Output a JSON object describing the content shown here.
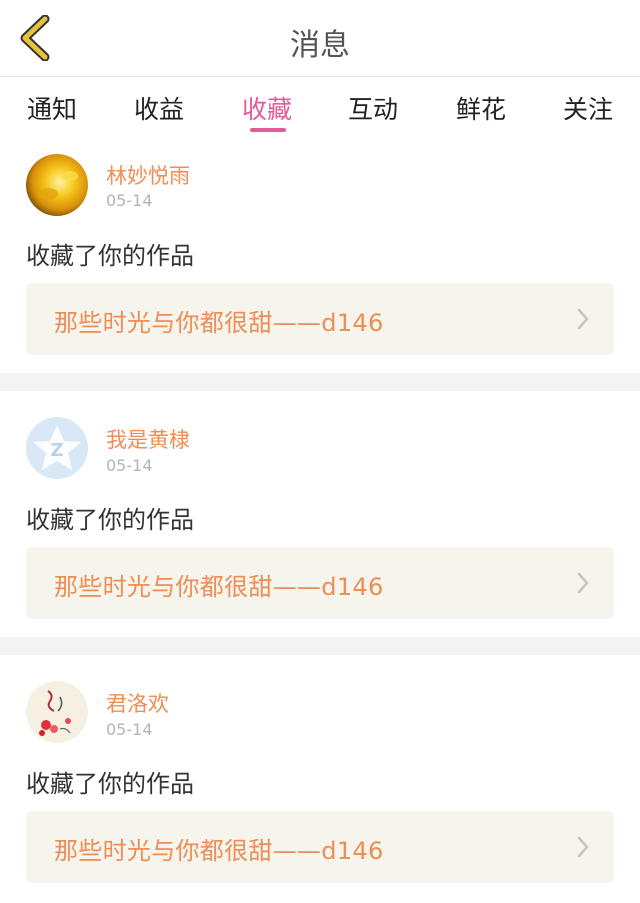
{
  "header": {
    "title": "消息",
    "back_icon": "chevron-left-icon"
  },
  "tabs": [
    {
      "label": "通知",
      "active": false
    },
    {
      "label": "收益",
      "active": false
    },
    {
      "label": "收藏",
      "active": true
    },
    {
      "label": "互动",
      "active": false
    },
    {
      "label": "鲜花",
      "active": false
    },
    {
      "label": "关注",
      "active": false
    }
  ],
  "messages": [
    {
      "user": "林妙悦雨",
      "time": "05-14",
      "action": "收藏了你的作品",
      "work": "那些时光与你都很甜——d146",
      "avatar": "sunflower-avatar"
    },
    {
      "user": "我是黄棣",
      "time": "05-14",
      "action": "收藏了你的作品",
      "work": "那些时光与你都很甜——d146",
      "avatar": "default-qq-avatar"
    },
    {
      "user": "君洛欢",
      "time": "05-14",
      "action": "收藏了你的作品",
      "work": "那些时光与你都很甜——d146",
      "avatar": "floral-calligraphy-avatar"
    }
  ],
  "colors": {
    "accent": "#e35b9a",
    "username": "#ef8d55",
    "box_bg": "#f5f5ee",
    "back_icon": "#e8c23a"
  }
}
